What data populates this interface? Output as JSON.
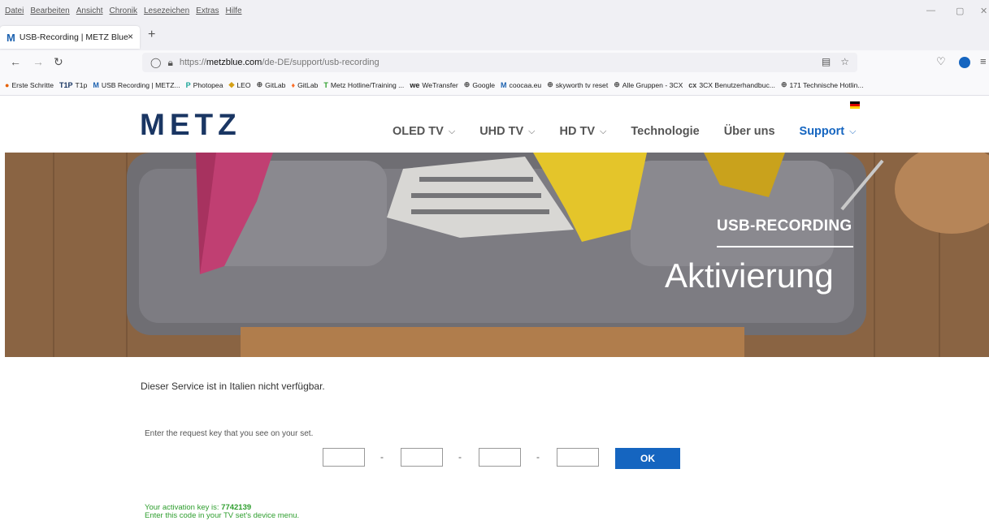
{
  "browser": {
    "menu": [
      "Datei",
      "Bearbeiten",
      "Ansicht",
      "Chronik",
      "Lesezeichen",
      "Extras",
      "Hilfe"
    ],
    "tab": {
      "favicon": "M",
      "title": "USB-Recording | METZ Blue",
      "close": "×"
    },
    "new_tab": "+",
    "url": {
      "prefix": "https://",
      "domain": "metzblue.com",
      "path": "/de-DE/support/usb-recording"
    },
    "bookmarks": [
      {
        "icon": "firefox-icon",
        "label": "Erste Schritte"
      },
      {
        "icon": "t1p-icon",
        "glyph": "T1P",
        "label": "T1p"
      },
      {
        "icon": "metz-icon",
        "glyph": "M",
        "label": "USB Recording | METZ..."
      },
      {
        "icon": "photopea-icon",
        "glyph": "P",
        "label": "Photopea"
      },
      {
        "icon": "leo-icon",
        "glyph": "◆",
        "label": "LEO"
      },
      {
        "icon": "globe-icon",
        "glyph": "⊕",
        "label": "GitLab"
      },
      {
        "icon": "gitlab-icon",
        "glyph": "♦",
        "label": "GitLab"
      },
      {
        "icon": "metz-green-icon",
        "glyph": "T",
        "label": "Metz Hotline/Training ..."
      },
      {
        "icon": "wetransfer-icon",
        "glyph": "we",
        "label": "WeTransfer"
      },
      {
        "icon": "globe-icon",
        "glyph": "⊕",
        "label": "Google"
      },
      {
        "icon": "metz-icon",
        "glyph": "M",
        "label": "coocaa.eu"
      },
      {
        "icon": "globe-icon",
        "glyph": "⊕",
        "label": "skyworth tv reset"
      },
      {
        "icon": "globe-icon",
        "glyph": "⊕",
        "label": "Alle Gruppen - 3CX"
      },
      {
        "icon": "3cx-icon",
        "glyph": "cx",
        "label": "3CX Benutzerhandbuc..."
      },
      {
        "icon": "globe-icon",
        "glyph": "⊕",
        "label": "171 Technische Hotlin..."
      }
    ]
  },
  "site": {
    "logo": "METZ",
    "nav": [
      {
        "label": "OLED TV",
        "has_dropdown": true,
        "active": false
      },
      {
        "label": "UHD TV",
        "has_dropdown": true,
        "active": false
      },
      {
        "label": "HD TV",
        "has_dropdown": true,
        "active": false
      },
      {
        "label": "Technologie",
        "has_dropdown": false,
        "active": false
      },
      {
        "label": "Über uns",
        "has_dropdown": false,
        "active": false
      },
      {
        "label": "Support",
        "has_dropdown": true,
        "active": true
      }
    ],
    "accent_color": "#1565c0",
    "logo_color": "#1a3663"
  },
  "hero": {
    "kicker": "USB-RECORDING",
    "title": "Aktivierung"
  },
  "content": {
    "notice": "Dieser Service ist in Italien nicht verfügbar.",
    "prompt": "Enter the request key that you see on your set.",
    "key_fields": [
      "",
      "",
      "",
      ""
    ],
    "separator": "-",
    "ok_label": "OK",
    "result_prefix": "Your activation key is: ",
    "activation_key": "7742139",
    "result_instruction": "Enter this code in your TV set's device menu.",
    "result_color": "#2e9e2e"
  }
}
